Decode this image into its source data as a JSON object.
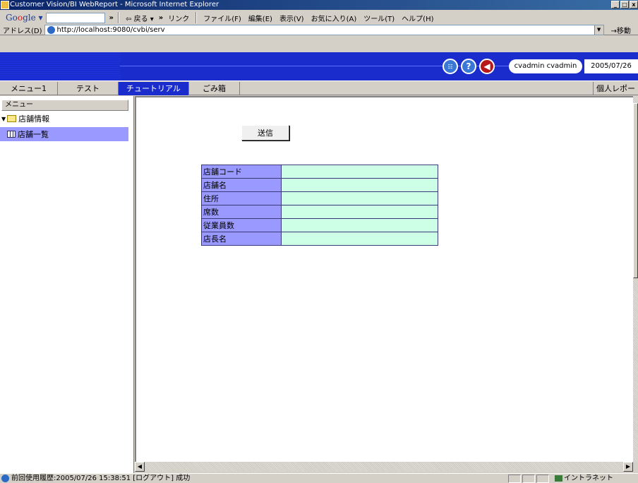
{
  "window": {
    "title": "Customer Vision/BI WebReport - Microsoft Internet Explorer",
    "buttons": [
      "_",
      "□",
      "x"
    ]
  },
  "toolbar": {
    "google_logo_g": "G",
    "google_logo_o1": "o",
    "google_logo_o2": "o",
    "google_logo_rest": "gle",
    "google_dropdown": "▾",
    "chevron": "»",
    "back": "⇦ 戻る ▾",
    "links": "リンク",
    "menus": [
      "ファイル(F)",
      "編集(E)",
      "表示(V)",
      "お気に入り(A)",
      "ツール(T)",
      "ヘルプ(H)"
    ]
  },
  "address": {
    "label": "アドレス(D)",
    "url": "http://localhost:9080/cvbi/serv",
    "go": "→移動"
  },
  "header": {
    "icon1": "☷",
    "icon2": "?",
    "icon3": "◀",
    "user": "cvadmin cvadmin",
    "date": "2005/07/26"
  },
  "tabs": [
    {
      "label": "メニュー1",
      "active": false
    },
    {
      "label": "テスト",
      "active": false
    },
    {
      "label": "チュートリアル",
      "active": true
    },
    {
      "label": "ごみ箱",
      "active": false
    }
  ],
  "tab_right": "個人レポート",
  "sidebar": {
    "header": "メニュー",
    "folder": "店舗情報",
    "tri": "▼",
    "item": "店舗一覧"
  },
  "form": {
    "submit": "送信",
    "fields": [
      {
        "label": "店舗コード",
        "value": ""
      },
      {
        "label": "店舗名",
        "value": ""
      },
      {
        "label": "住所",
        "value": ""
      },
      {
        "label": "席数",
        "value": ""
      },
      {
        "label": "従業員数",
        "value": ""
      },
      {
        "label": "店長名",
        "value": ""
      }
    ]
  },
  "scroll": {
    "left": "◀",
    "right": "▶"
  },
  "status": {
    "text": "前回使用履歴:2005/07/26 15:38:51 [ログアウト] 成功",
    "zone": "イントラネット"
  },
  "colors": {
    "header_blue": "#1a2ccc",
    "label_bg": "#9999ff",
    "value_bg": "#ccffe6"
  }
}
